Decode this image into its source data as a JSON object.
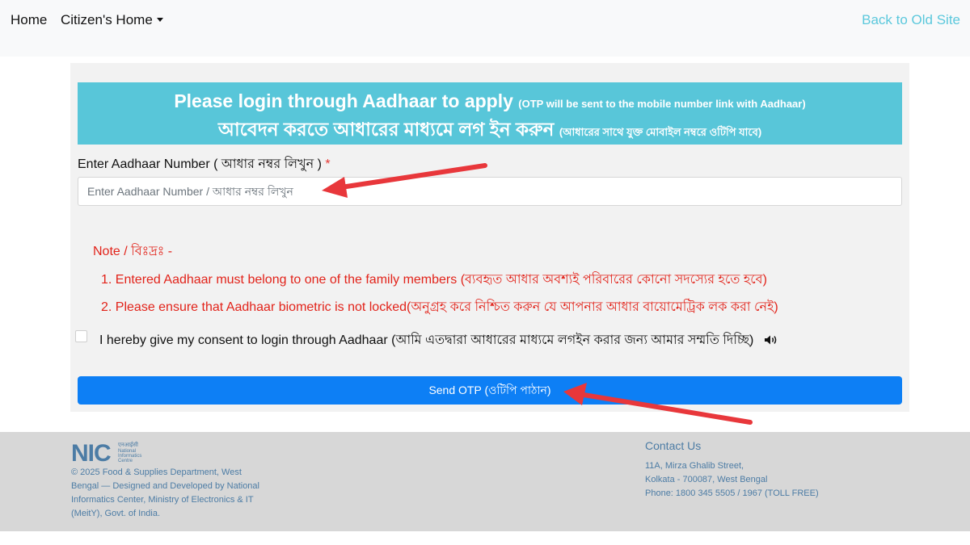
{
  "nav": {
    "home": "Home",
    "citizens_home": "Citizen's Home",
    "back_to_old_site": "Back to Old Site"
  },
  "banner": {
    "line1_main": "Please login through Aadhaar to apply",
    "line1_small": "(OTP will be sent to the mobile number link with Aadhaar)",
    "line2_main": "আবেদন করতে আধারের মাধ্যমে লগ ইন করুন",
    "line2_small": "(আধারের সাথে যুক্ত মোবাইল নম্বরে ওটিপি যাবে)"
  },
  "aadhaar_field": {
    "label": "Enter Aadhaar Number ( আধার নম্বর লিখুন )",
    "required_mark": "*",
    "placeholder": "Enter Aadhaar Number / আধার নম্বর লিখুন",
    "value": ""
  },
  "note": {
    "title": "Note / বিঃদ্রঃ -",
    "items": [
      "1. Entered Aadhaar must belong to one of the family members (ব্যবহৃত আধার অবশ্যই পরিবারের কোনো সদস্যের হতে হবে)",
      "2. Please ensure that Aadhaar biometric is not locked(অনুগ্রহ করে নিশ্চিত করুন যে আপনার আধার বায়োমেট্রিক লক করা নেই)"
    ]
  },
  "consent": {
    "text": "I hereby give my consent to login through Aadhaar (আমি এতদ্বারা আধারের মাধ্যমে লগইন করার জন্য আমার সম্মতি দিচ্ছি)",
    "checked": false,
    "icon": "speaker-icon"
  },
  "send_otp_button": "Send OTP (ওটিপি পাঠান)",
  "footer": {
    "logo_text": "NIC",
    "logo_subtext": "National Informatics Centre",
    "copyright": "© 2025 Food & Supplies Department, West Bengal — Designed and Developed by National Informatics Center, Ministry of Electronics & IT (MeitY), Govt. of India.",
    "contact_title": "Contact Us",
    "address_line1": "11A, Mirza Ghalib Street,",
    "address_line2": "Kolkata - 700087, West Bengal",
    "phone": "Phone: 1800 345 5505 / 1967 (TOLL FREE)"
  },
  "colors": {
    "banner_bg": "#58c6d9",
    "accent_blue": "#0d7ff5",
    "note_red": "#e2231a",
    "link_cyan": "#5bc8dc",
    "footer_text": "#4c7ca5",
    "annotation_arrow": "#e8373b"
  }
}
